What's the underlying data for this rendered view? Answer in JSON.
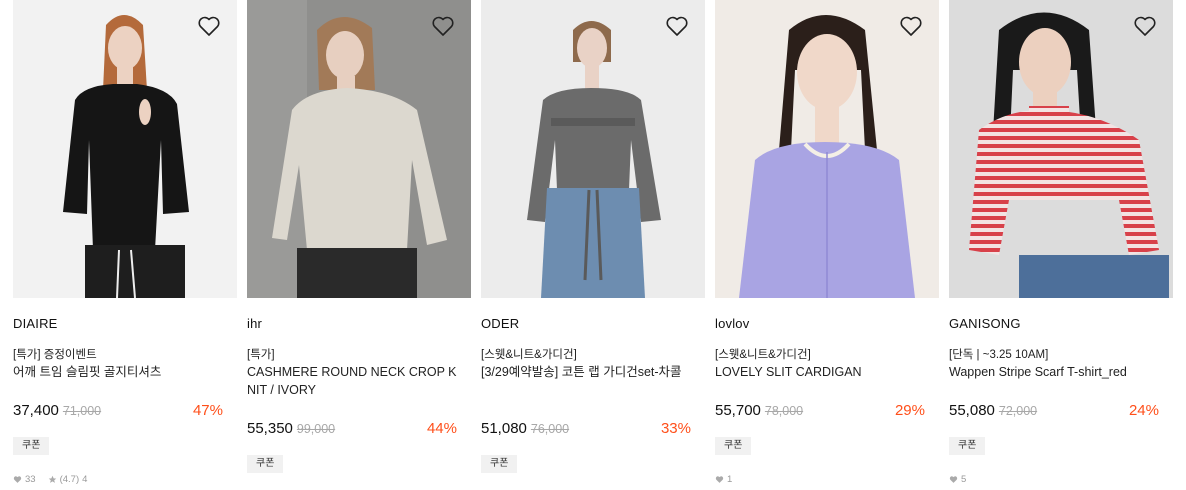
{
  "products": [
    {
      "brand": "DIAIRE",
      "tag": "[특가] 증정이벤트",
      "title": "어깨 트임 슬림핏 골지티셔츠",
      "price": "37,400",
      "original_price": "71,000",
      "discount": "47%",
      "coupon": "쿠폰",
      "likes": "33",
      "rating": "(4.7)",
      "reviews": "4",
      "photo": {
        "bg": "#f2f2f2",
        "garment": "#151515",
        "hair": "#b46a3b",
        "skin": "#ecd2c2",
        "bottom": "#1e1e1e"
      }
    },
    {
      "brand": "ihr",
      "tag": "[특가]",
      "title": "CASHMERE ROUND NECK CROP KNIT / IVORY",
      "price": "55,350",
      "original_price": "99,000",
      "discount": "44%",
      "coupon": "쿠폰",
      "photo": {
        "bg": "#8f8f8d",
        "garment": "#dcd8cf",
        "hair": "#a27a58",
        "skin": "#e7cfc0",
        "bottom": "#2a2a2a"
      }
    },
    {
      "brand": "ODER",
      "tag": "[스웻&니트&가디건]",
      "title": "[3/29예약발송] 코튼 랩 가디건set-차콜",
      "price": "51,080",
      "original_price": "76,000",
      "discount": "33%",
      "coupon": "쿠폰",
      "photo": {
        "bg": "#ececec",
        "garment": "#6b6b6b",
        "hair": "#8e6a4c",
        "skin": "#e9d2c6",
        "bottom": "#6d8db0"
      }
    },
    {
      "brand": "lovlov",
      "tag": "[스웻&니트&가디건]",
      "title": "LOVELY SLIT CARDIGAN",
      "price": "55,700",
      "original_price": "78,000",
      "discount": "29%",
      "coupon": "쿠폰",
      "likes": "1",
      "photo": {
        "bg": "#f0ebe6",
        "garment": "#a9a4e3",
        "hair": "#2b1f1a",
        "skin": "#f0d8c9",
        "bottom": "#a9a4e3"
      }
    },
    {
      "brand": "GANISONG",
      "tag": "[단독 | ~3.25 10AM]",
      "title": "Wappen Stripe Scarf T-shirt_red",
      "price": "55,080",
      "original_price": "72,000",
      "discount": "24%",
      "coupon": "쿠폰",
      "likes": "5",
      "photo": {
        "bg": "#dcdcdc",
        "garment": "#d8414a",
        "hair": "#1a1a1a",
        "skin": "#ecd0bf",
        "bottom": "#4d6f9a"
      }
    }
  ]
}
